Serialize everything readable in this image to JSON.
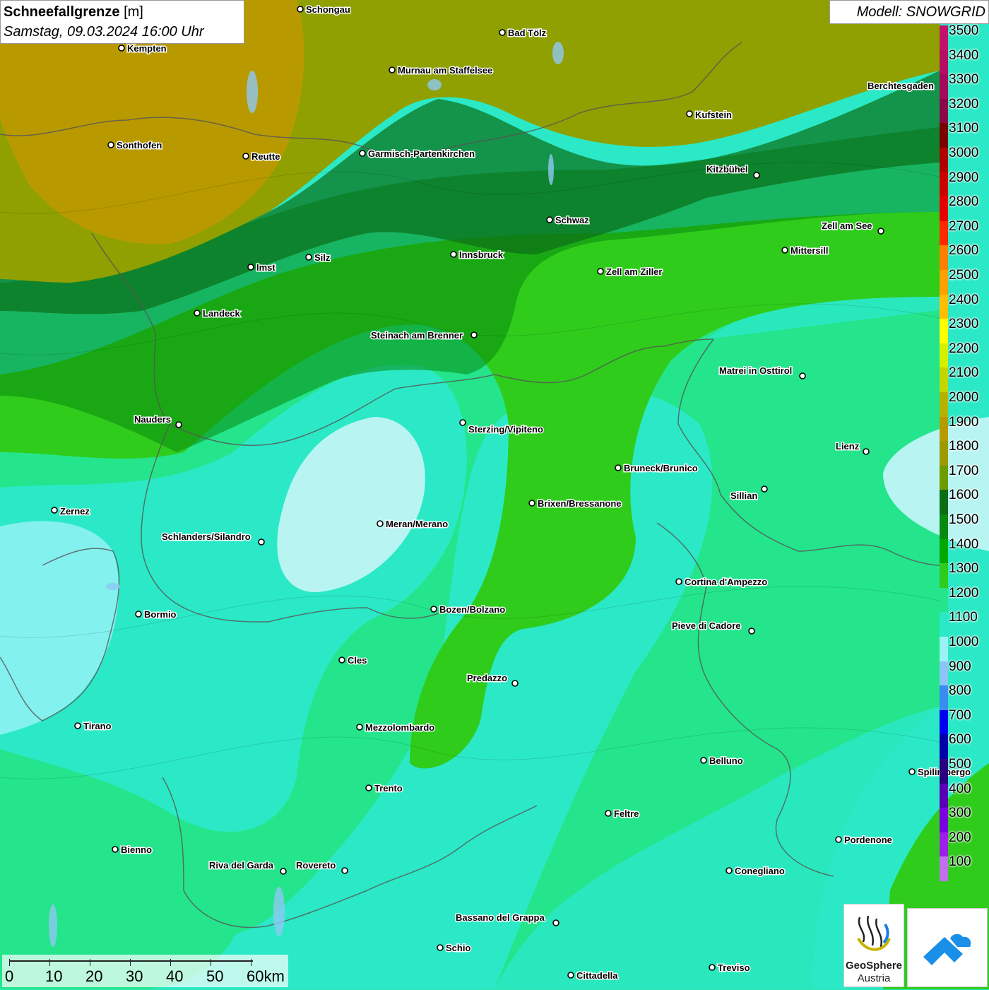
{
  "title": {
    "parameter": "Schneefallgrenze",
    "unit": "[m]",
    "datetime": "Samstag, 09.03.2024 16:00 Uhr"
  },
  "model": "Modell: SNOWGRID",
  "legend": [
    {
      "value": "3500",
      "color": "#c2126b"
    },
    {
      "value": "3400",
      "color": "#b40f62"
    },
    {
      "value": "3300",
      "color": "#a30a5a"
    },
    {
      "value": "3200",
      "color": "#8c0748"
    },
    {
      "value": "3100",
      "color": "#7a0000"
    },
    {
      "value": "3000",
      "color": "#b00000"
    },
    {
      "value": "2900",
      "color": "#cc0000"
    },
    {
      "value": "2800",
      "color": "#e60000"
    },
    {
      "value": "2700",
      "color": "#ff2a00"
    },
    {
      "value": "2600",
      "color": "#ff7f00"
    },
    {
      "value": "2500",
      "color": "#ff9f00"
    },
    {
      "value": "2400",
      "color": "#ffbf00"
    },
    {
      "value": "2300",
      "color": "#ffff00"
    },
    {
      "value": "2200",
      "color": "#d4f000"
    },
    {
      "value": "2100",
      "color": "#c3d600"
    },
    {
      "value": "2000",
      "color": "#b5b300"
    },
    {
      "value": "1900",
      "color": "#b89a00"
    },
    {
      "value": "1800",
      "color": "#9c9a00"
    },
    {
      "value": "1700",
      "color": "#6e9b00"
    },
    {
      "value": "1600",
      "color": "#0b6e17"
    },
    {
      "value": "1500",
      "color": "#078a0f"
    },
    {
      "value": "1400",
      "color": "#00a800"
    },
    {
      "value": "1300",
      "color": "#2fcc1c"
    },
    {
      "value": "1200",
      "color": "#24e58c"
    },
    {
      "value": "1100",
      "color": "#2be9c6"
    },
    {
      "value": "1000",
      "color": "#9af2f7"
    },
    {
      "value": "900",
      "color": "#8cc5f5"
    },
    {
      "value": "800",
      "color": "#3a8cf0"
    },
    {
      "value": "700",
      "color": "#0000ee"
    },
    {
      "value": "600",
      "color": "#0000a8"
    },
    {
      "value": "500",
      "color": "#2a0080"
    },
    {
      "value": "400",
      "color": "#5a00b4"
    },
    {
      "value": "300",
      "color": "#7a00e0"
    },
    {
      "value": "200",
      "color": "#9e20e8"
    },
    {
      "value": "100",
      "color": "#c070ee"
    }
  ],
  "cities": [
    {
      "name": "Schongau"
    },
    {
      "name": "Bad Tölz"
    },
    {
      "name": "Kempten"
    },
    {
      "name": "Murnau am Staffelsee"
    },
    {
      "name": "Berchtesgaden"
    },
    {
      "name": "Kufstein"
    },
    {
      "name": "Sonthofen"
    },
    {
      "name": "Reutte"
    },
    {
      "name": "Garmisch-Partenkirchen"
    },
    {
      "name": "Kitzbühel"
    },
    {
      "name": "Schwaz"
    },
    {
      "name": "Zell am See"
    },
    {
      "name": "Mittersill"
    },
    {
      "name": "Innsbruck"
    },
    {
      "name": "Imst"
    },
    {
      "name": "Silz"
    },
    {
      "name": "Zell am Ziller"
    },
    {
      "name": "Landeck"
    },
    {
      "name": "Steinach am Brenner"
    },
    {
      "name": "Matrei in Osttirol"
    },
    {
      "name": "Nauders"
    },
    {
      "name": "Sterzing/Vipiteno"
    },
    {
      "name": "Lienz"
    },
    {
      "name": "Bruneck/Brunico"
    },
    {
      "name": "Sillian"
    },
    {
      "name": "Brixen/Bressanone"
    },
    {
      "name": "Zernez"
    },
    {
      "name": "Meran/Merano"
    },
    {
      "name": "Schlanders/Silandro"
    },
    {
      "name": "Cortina d'Ampezzo"
    },
    {
      "name": "Bormio"
    },
    {
      "name": "Bozen/Bolzano"
    },
    {
      "name": "Pieve di Cadore"
    },
    {
      "name": "Cles"
    },
    {
      "name": "Predazzo"
    },
    {
      "name": "Tirano"
    },
    {
      "name": "Mezzolombardo"
    },
    {
      "name": "Belluno"
    },
    {
      "name": "Spilimbergo"
    },
    {
      "name": "Trento"
    },
    {
      "name": "Feltre"
    },
    {
      "name": "Pordenone"
    },
    {
      "name": "Bienno"
    },
    {
      "name": "Riva del Garda"
    },
    {
      "name": "Rovereto"
    },
    {
      "name": "Conegliano"
    },
    {
      "name": "Bassano del Grappa"
    },
    {
      "name": "Schio"
    },
    {
      "name": "Treviso"
    },
    {
      "name": "Cittadella"
    }
  ],
  "scalebar": [
    "0",
    "10",
    "20",
    "30",
    "40",
    "50",
    "60km"
  ],
  "logo": {
    "line1": "GeoSphere",
    "line2": "Austria"
  }
}
